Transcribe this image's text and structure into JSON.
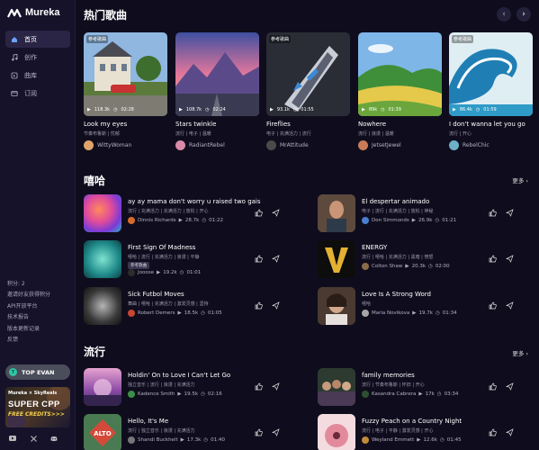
{
  "app": {
    "name": "Mureka"
  },
  "sidebar": {
    "nav": [
      {
        "label": "首页",
        "icon": "home-icon"
      },
      {
        "label": "创作",
        "icon": "music-note-icon"
      },
      {
        "label": "曲库",
        "icon": "library-icon"
      },
      {
        "label": "订阅",
        "icon": "subscription-icon"
      }
    ],
    "links": [
      "积分: 2",
      "邀请好友获得积分",
      "API开放平台",
      "技术报告",
      "版本更新记录",
      "反馈"
    ],
    "user": {
      "initial": "T",
      "name": "TOP EVAN"
    },
    "promo": {
      "top": "Mureka × SkyReels",
      "title": "SUPER CPP",
      "subtitle": "FREE CREDITS>>>"
    },
    "socials": [
      "youtube-icon",
      "x-icon",
      "discord-icon"
    ]
  },
  "hot": {
    "title": "热门歌曲",
    "cards": [
      {
        "badge": "参考歌曲",
        "plays": "118.3k",
        "duration": "02:28",
        "title": "Look my eyes",
        "tags": "节奏布鲁斯 | 忧郁",
        "user": "WittyWoman",
        "avatar": "#e0a46a"
      },
      {
        "badge": "",
        "plays": "108.7k",
        "duration": "02:24",
        "title": "Stars twinkle",
        "tags": "流行 | 电子 | 温暖",
        "user": "RadiantRebel",
        "avatar": "#d98aa8"
      },
      {
        "badge": "参考歌曲",
        "plays": "93.1k",
        "duration": "01:55",
        "title": "Fireflies",
        "tags": "电子 | 充满活力 | 流行",
        "user": "MrAttitude",
        "avatar": "#4a4a4a"
      },
      {
        "badge": "",
        "plays": "89k",
        "duration": "01:39",
        "title": "Nowhere",
        "tags": "流行 | 浪漫 | 温暖",
        "user": "JetsetJewel",
        "avatar": "#c97b57"
      },
      {
        "badge": "参考歌曲",
        "plays": "86.4k",
        "duration": "01:59",
        "title": "I don't wanna let you go",
        "tags": "流行 | 开心",
        "user": "RebelChic",
        "avatar": "#6fb0c9"
      }
    ]
  },
  "hiphop": {
    "title": "嘻哈",
    "more": "更多",
    "rows": [
      {
        "title": "ay ay mama don't worry u raised two gais",
        "tags": "流行 | 充满活力 | 充满活力 | 放松 | 开心",
        "badge": "",
        "user": "Dinnis Richards",
        "plays": "28.7k",
        "duration": "01:22",
        "avatar": "#d86a2a"
      },
      {
        "title": "El despertar animado",
        "tags": "电子 | 流行 | 充满活力 | 放松 | 神秘",
        "badge": "",
        "user": "Don Simmonds",
        "plays": "26.9k",
        "duration": "01:21",
        "avatar": "#4a7fd0"
      },
      {
        "title": "First Sign Of Madness",
        "tags": "嘻哈 | 流行 | 充满活力 | 浪漫 | 平静",
        "badge": "参考歌曲",
        "user": "Jooose",
        "plays": "19.2k",
        "duration": "01:01",
        "avatar": "#2c2c2c"
      },
      {
        "title": "ENERGY",
        "tags": "流行 | 嘻哈 | 充满活力 | 黑暗 | 愤怒",
        "badge": "",
        "user": "Colton Shaw",
        "plays": "20.3k",
        "duration": "02:00",
        "avatar": "#8a6a4a"
      },
      {
        "title": "Sick Futbol Moves",
        "tags": "舞曲 | 嘻哈 | 充满活力 | 激发灵感 | 坚持",
        "badge": "",
        "user": "Robert Demers",
        "plays": "18.5k",
        "duration": "01:05",
        "avatar": "#c7462f"
      },
      {
        "title": "Love Is A Strong Word",
        "tags": "嘻哈",
        "badge": "",
        "user": "Maria Novikova",
        "plays": "19.7k",
        "duration": "01:34",
        "avatar": "#a7a7a7"
      }
    ]
  },
  "popular": {
    "title": "流行",
    "more": "更多",
    "rows": [
      {
        "title": "Holdin' On to Love I Can't Let Go",
        "tags": "独立音乐 | 流行 | 浪漫 | 充满活力",
        "user": "Kadence Smith",
        "plays": "19.5k",
        "duration": "02:16",
        "avatar": "#3b8f46"
      },
      {
        "title": "family memories",
        "tags": "流行 | 节奏布鲁斯 | 怀旧 | 开心",
        "user": "Kasandra Cabrera",
        "plays": "17k",
        "duration": "03:34",
        "avatar": "#2e5030"
      },
      {
        "title": "Hello, It's Me",
        "tags": "流行 | 独立音乐 | 浪漫 | 充满活力",
        "user": "Shandi Buckhelt",
        "plays": "17.3k",
        "duration": "01:40",
        "avatar": "#777"
      },
      {
        "title": "Fuzzy Peach on a Country Night",
        "tags": "流行 | 电子 | 平静 | 激发灵感 | 开心",
        "user": "Weyland Emmett",
        "plays": "12.6k",
        "duration": "01:45",
        "avatar": "#c08a3a"
      }
    ]
  }
}
